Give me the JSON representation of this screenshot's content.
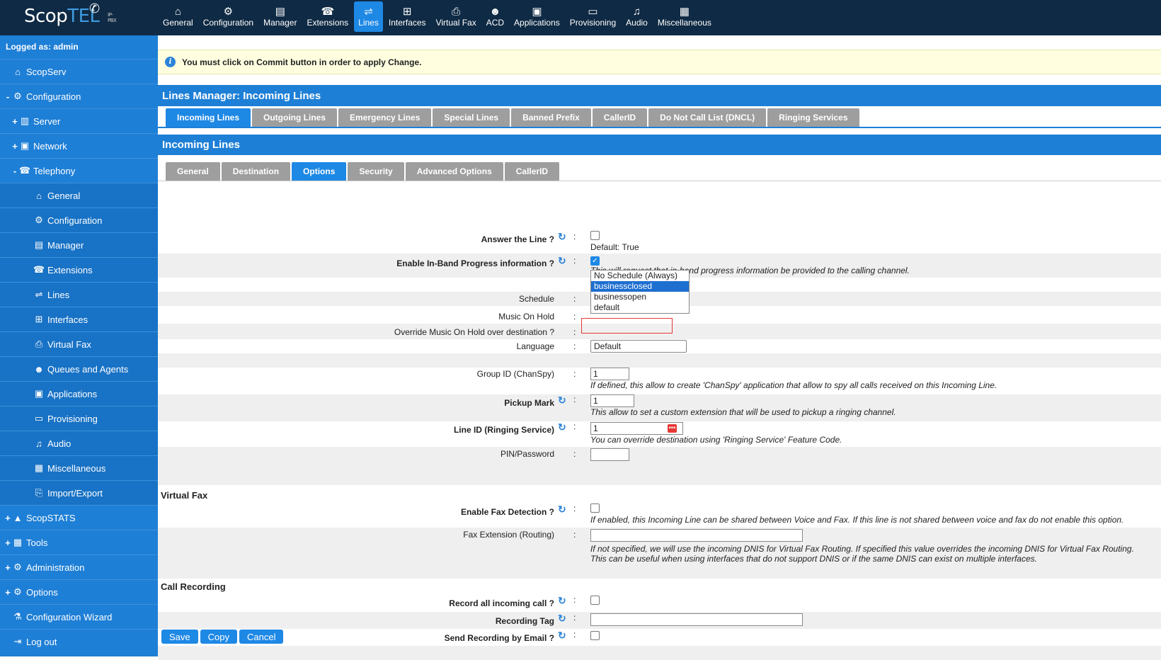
{
  "logo": {
    "brand_a": "Scop",
    "brand_b": "TEL",
    "tagline": "IP-PBX"
  },
  "topnav": [
    {
      "label": "General",
      "icon": "home-icon",
      "glyph": "⌂",
      "active": false
    },
    {
      "label": "Configuration",
      "icon": "gear-icon",
      "glyph": "⚙",
      "active": false
    },
    {
      "label": "Manager",
      "icon": "manager-icon",
      "glyph": "▤",
      "active": false
    },
    {
      "label": "Extensions",
      "icon": "extensions-icon",
      "glyph": "☎",
      "active": false
    },
    {
      "label": "Lines",
      "icon": "lines-icon",
      "glyph": "⇌",
      "active": true
    },
    {
      "label": "Interfaces",
      "icon": "interfaces-icon",
      "glyph": "⊞",
      "active": false
    },
    {
      "label": "Virtual Fax",
      "icon": "fax-icon",
      "glyph": "⎙",
      "active": false
    },
    {
      "label": "ACD",
      "icon": "agent-icon",
      "glyph": "☻",
      "active": false
    },
    {
      "label": "Applications",
      "icon": "applications-icon",
      "glyph": "▣",
      "active": false
    },
    {
      "label": "Provisioning",
      "icon": "provisioning-icon",
      "glyph": "▭",
      "active": false
    },
    {
      "label": "Audio",
      "icon": "music-icon",
      "glyph": "♫",
      "active": false
    },
    {
      "label": "Miscellaneous",
      "icon": "misc-icon",
      "glyph": "▦",
      "active": false
    }
  ],
  "sidebar": {
    "logged_as": "Logged as: admin",
    "items": [
      {
        "label": "ScopServ",
        "icon": "home-icon",
        "glyph": "⌂",
        "exp": "",
        "level": 0
      },
      {
        "label": "Configuration",
        "icon": "gear-icon",
        "glyph": "⚙",
        "exp": "-",
        "level": 0
      },
      {
        "label": "Server",
        "icon": "server-icon",
        "glyph": "▥",
        "exp": "+",
        "level": 1
      },
      {
        "label": "Network",
        "icon": "network-icon",
        "glyph": "▣",
        "exp": "+",
        "level": 1
      },
      {
        "label": "Telephony",
        "icon": "telephony-icon",
        "glyph": "☎",
        "exp": "-",
        "level": 1
      },
      {
        "label": "General",
        "icon": "home-icon",
        "glyph": "⌂",
        "exp": "",
        "level": 2
      },
      {
        "label": "Configuration",
        "icon": "gear-icon",
        "glyph": "⚙",
        "exp": "",
        "level": 2
      },
      {
        "label": "Manager",
        "icon": "manager-icon",
        "glyph": "▤",
        "exp": "",
        "level": 2
      },
      {
        "label": "Extensions",
        "icon": "extensions-icon",
        "glyph": "☎",
        "exp": "",
        "level": 2
      },
      {
        "label": "Lines",
        "icon": "lines-icon",
        "glyph": "⇌",
        "exp": "",
        "level": 2
      },
      {
        "label": "Interfaces",
        "icon": "interfaces-icon",
        "glyph": "⊞",
        "exp": "",
        "level": 2
      },
      {
        "label": "Virtual Fax",
        "icon": "fax-icon",
        "glyph": "⎙",
        "exp": "",
        "level": 2
      },
      {
        "label": "Queues and Agents",
        "icon": "agent-icon",
        "glyph": "☻",
        "exp": "",
        "level": 2
      },
      {
        "label": "Applications",
        "icon": "applications-icon",
        "glyph": "▣",
        "exp": "",
        "level": 2
      },
      {
        "label": "Provisioning",
        "icon": "provisioning-icon",
        "glyph": "▭",
        "exp": "",
        "level": 2
      },
      {
        "label": "Audio",
        "icon": "music-icon",
        "glyph": "♫",
        "exp": "",
        "level": 2
      },
      {
        "label": "Miscellaneous",
        "icon": "misc-icon",
        "glyph": "▦",
        "exp": "",
        "level": 2
      },
      {
        "label": "Import/Export",
        "icon": "import-export-icon",
        "glyph": "⎘",
        "exp": "",
        "level": 2
      },
      {
        "label": "ScopSTATS",
        "icon": "stats-icon",
        "glyph": "▲",
        "exp": "+",
        "level": 0
      },
      {
        "label": "Tools",
        "icon": "tools-icon",
        "glyph": "▦",
        "exp": "+",
        "level": 0
      },
      {
        "label": "Administration",
        "icon": "admin-icon",
        "glyph": "⚙",
        "exp": "+",
        "level": 0
      },
      {
        "label": "Options",
        "icon": "gear-icon",
        "glyph": "⚙",
        "exp": "+",
        "level": 0
      },
      {
        "label": "Configuration Wizard",
        "icon": "wizard-icon",
        "glyph": "⚗",
        "exp": "",
        "level": 0
      },
      {
        "label": "Log out",
        "icon": "logout-icon",
        "glyph": "⇥",
        "exp": "",
        "level": 0
      }
    ]
  },
  "notice": "You must click on Commit button in order to apply Change.",
  "manager_title": "Lines Manager:  Incoming Lines",
  "main_tabs": [
    {
      "label": "Incoming Lines",
      "active": true
    },
    {
      "label": "Outgoing Lines",
      "active": false
    },
    {
      "label": "Emergency Lines",
      "active": false
    },
    {
      "label": "Special Lines",
      "active": false
    },
    {
      "label": "Banned Prefix",
      "active": false
    },
    {
      "label": "CallerID",
      "active": false
    },
    {
      "label": "Do Not Call List (DNCL)",
      "active": false
    },
    {
      "label": "Ringing Services",
      "active": false
    }
  ],
  "section_title": "Incoming Lines",
  "sub_tabs": [
    {
      "label": "General",
      "active": false
    },
    {
      "label": "Destination",
      "active": false
    },
    {
      "label": "Options",
      "active": true
    },
    {
      "label": "Security",
      "active": false
    },
    {
      "label": "Advanced Options",
      "active": false
    },
    {
      "label": "CallerID",
      "active": false
    }
  ],
  "form": {
    "answer_line": {
      "label": "Answer the Line ?",
      "default_text": "Default: True"
    },
    "inband": {
      "label": "Enable In-Band Progress information ?",
      "note": "This will request that in-band progress information be provided to the calling channel."
    },
    "schedule": {
      "label": "Schedule",
      "value": "businessopen",
      "options": [
        "No Schedule (Always)",
        "businessclosed",
        "businessopen",
        "default"
      ],
      "highlighted": "businessclosed"
    },
    "moh": {
      "label": "Music On Hold"
    },
    "override_moh": {
      "label": "Override Music On Hold over destination ?"
    },
    "language": {
      "label": "Language",
      "value": "Default"
    },
    "group_id": {
      "label": "Group ID (ChanSpy)",
      "value": "1",
      "note": "If defined, this allow to create 'ChanSpy' application that allow to spy all calls received on this Incoming Line."
    },
    "pickup_mark": {
      "label": "Pickup Mark",
      "value": "1",
      "note": "This allow to set a custom extension that will be used to pickup a ringing channel."
    },
    "line_id": {
      "label": "Line ID (Ringing Service)",
      "value": "1",
      "note": "You can override destination using 'Ringing Service' Feature Code."
    },
    "pin": {
      "label": "PIN/Password",
      "value": ""
    },
    "virtual_fax_title": "Virtual Fax",
    "fax_detect": {
      "label": "Enable Fax Detection ?",
      "note": "If enabled, this Incoming Line can be shared between Voice and Fax. If this line is not shared between voice and fax do not enable this option."
    },
    "fax_ext": {
      "label": "Fax Extension (Routing)",
      "value": "",
      "note1": "If not specified, we will use the incoming DNIS for Virtual Fax Routing. If specified this value overrides the incoming DNIS for Virtual Fax Routing.",
      "note2": "This can be useful when using interfaces that do not support DNIS or if the same DNIS can exist on multiple interfaces."
    },
    "call_recording_title": "Call Recording",
    "record_all": {
      "label": "Record all incoming call ?"
    },
    "recording_tag": {
      "label": "Recording Tag",
      "value": ""
    },
    "send_email": {
      "label": "Send Recording by Email ?"
    }
  },
  "buttons": {
    "save": "Save",
    "copy": "Copy",
    "cancel": "Cancel"
  },
  "colors": {
    "topbar": "#0f2a44",
    "accent": "#1e88e5",
    "sidebar": "#1e7fd6",
    "notice_bg": "#ffffe0",
    "tab_inactive": "#9e9e9e"
  }
}
